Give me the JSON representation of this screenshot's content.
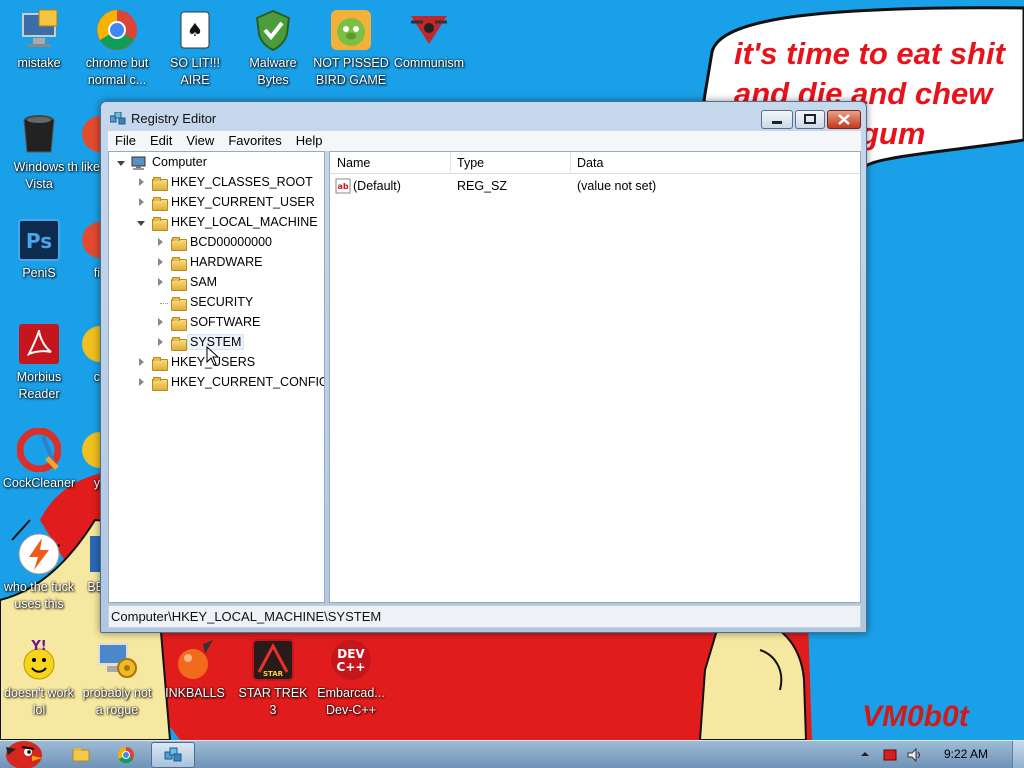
{
  "wallpaper": {
    "caption_lines": [
      "it's time to eat shit",
      "and die and chew",
      "gum"
    ],
    "signature": "VM0b0t"
  },
  "desktop_icons": [
    {
      "label": "mistake",
      "icon": "computer-icon"
    },
    {
      "label": "chrome but normal c...",
      "icon": "chrome-icon"
    },
    {
      "label": "SO LIT!!! AIRE",
      "icon": "playing-card-icon"
    },
    {
      "label": "Malware Bytes",
      "icon": "shield-check-icon"
    },
    {
      "label": "NOT PISSED BIRD GAME",
      "icon": "green-pig-icon"
    },
    {
      "label": "Communism",
      "icon": "hammer-sickle-icon"
    },
    {
      "label": "Windows Vista",
      "icon": "trash-bin-icon"
    },
    {
      "label": "th like",
      "icon": "partial-icon"
    },
    {
      "label": "PeniS",
      "icon": "photoshop-icon"
    },
    {
      "label": "fi",
      "icon": "partial-icon"
    },
    {
      "label": "Morbius Reader",
      "icon": "pdf-reader-icon"
    },
    {
      "label": "c",
      "icon": "partial-icon"
    },
    {
      "label": "CockCleaner",
      "icon": "ccleaner-icon"
    },
    {
      "label": "y",
      "icon": "partial-icon"
    },
    {
      "label": "who the fuck uses this",
      "icon": "lightning-icon"
    },
    {
      "label": "BE",
      "icon": "partial-icon"
    },
    {
      "label": "doesn't work lol",
      "icon": "yahoo-messenger-icon"
    },
    {
      "label": "probably not a rogue",
      "icon": "system-settings-icon"
    },
    {
      "label": "INKBALLS",
      "icon": "ink-ball-icon"
    },
    {
      "label": "STAR TREK 3",
      "icon": "star-wars-game-icon"
    },
    {
      "label": "Embarcad... Dev-C++",
      "icon": "dev-cpp-icon"
    }
  ],
  "window": {
    "title": "Registry Editor",
    "menu": [
      "File",
      "Edit",
      "View",
      "Favorites",
      "Help"
    ],
    "tree": [
      {
        "label": "Computer",
        "state": "open"
      },
      {
        "label": "HKEY_CLASSES_ROOT",
        "state": "closed"
      },
      {
        "label": "HKEY_CURRENT_USER",
        "state": "closed"
      },
      {
        "label": "HKEY_LOCAL_MACHINE",
        "state": "open"
      },
      {
        "label": "BCD00000000",
        "state": "closed"
      },
      {
        "label": "HARDWARE",
        "state": "closed"
      },
      {
        "label": "SAM",
        "state": "closed"
      },
      {
        "label": "SECURITY",
        "state": "none"
      },
      {
        "label": "SOFTWARE",
        "state": "closed"
      },
      {
        "label": "SYSTEM",
        "state": "closed",
        "selected": true
      },
      {
        "label": "HKEY_USERS",
        "state": "closed"
      },
      {
        "label": "HKEY_CURRENT_CONFIG",
        "state": "closed"
      }
    ],
    "columns": [
      "Name",
      "Type",
      "Data"
    ],
    "values": [
      {
        "name": "(Default)",
        "type": "REG_SZ",
        "data": "(value not set)"
      }
    ],
    "status_path": "Computer\\HKEY_LOCAL_MACHINE\\SYSTEM"
  },
  "taskbar": {
    "clock": "9:22 AM"
  }
}
